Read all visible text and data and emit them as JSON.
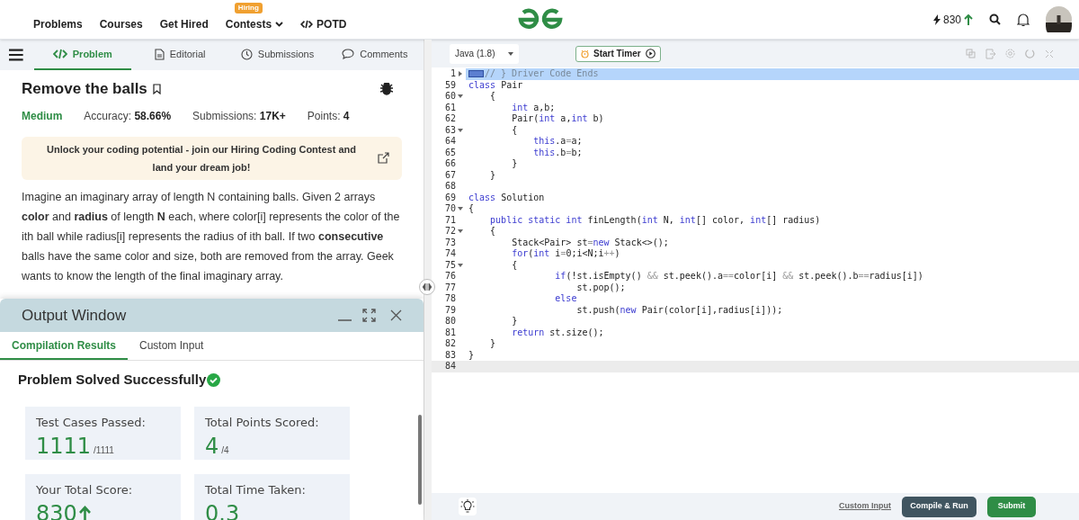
{
  "header": {
    "nav": [
      {
        "label": "Problems"
      },
      {
        "label": "Courses"
      },
      {
        "label": "Get Hired"
      },
      {
        "label": "Contests",
        "badge": "Hiring",
        "dropdown": true
      },
      {
        "label": "POTD",
        "code_icon": true
      }
    ],
    "streak": "830"
  },
  "tabs": [
    {
      "label": "Problem",
      "selected": true
    },
    {
      "label": "Editorial",
      "selected": false
    },
    {
      "label": "Submissions",
      "selected": false
    },
    {
      "label": "Comments",
      "selected": false
    }
  ],
  "problem": {
    "title": "Remove the balls",
    "difficulty": "Medium",
    "meta": [
      {
        "label": "Accuracy:",
        "value": "58.66%"
      },
      {
        "label": "Submissions:",
        "value": "17K+"
      },
      {
        "label": "Points:",
        "value": "4"
      }
    ],
    "banner": "Unlock your coding potential - join our Hiring Coding Contest and land your dream job!",
    "description": "Imagine an imaginary array of length N containing balls. Given 2 arrays **color** and **radius** of length **N** each, where color[i] represents the color of the ith ball while radius[i] represents the radius of ith ball. If two **consecutive** balls have the same color and size, both are removed from the array. Geek wants to know the length of the final imaginary array."
  },
  "output_window": {
    "title": "Output Window",
    "tabs": [
      {
        "label": "Compilation Results",
        "selected": true
      },
      {
        "label": "Custom Input",
        "selected": false
      }
    ],
    "status": "Problem Solved Successfully",
    "stats": [
      {
        "label": "Test Cases Passed:",
        "value": "1111",
        "total": "/1111"
      },
      {
        "label": "Total Points Scored:",
        "value": "4",
        "total": "/4"
      },
      {
        "label": "Your Total Score:",
        "value": "830",
        "arrow": true
      },
      {
        "label": "Total Time Taken:",
        "value": "0.3"
      }
    ]
  },
  "editor": {
    "language": "Java (1.8)",
    "timer_button": "Start Timer",
    "lines": [
      {
        "n": "1",
        "foldable": true,
        "collapsed": true,
        "selected": true,
        "fold_marker": true,
        "code": [
          {
            "t": "// } Driver Code Ends",
            "comment": true
          }
        ]
      },
      {
        "n": "59",
        "code": [
          {
            "t": "class",
            "keyword": true
          },
          {
            "t": " Pair"
          }
        ]
      },
      {
        "n": "60",
        "foldable": true,
        "collapsed": false,
        "code": [
          {
            "t": "    {"
          }
        ]
      },
      {
        "n": "61",
        "code": [
          {
            "t": "        int",
            "keyword": true
          },
          {
            "t": " a,b;"
          }
        ]
      },
      {
        "n": "62",
        "code": [
          {
            "t": "        Pair("
          },
          {
            "t": "int",
            "keyword": true
          },
          {
            "t": " a,"
          },
          {
            "t": "int",
            "keyword": true
          },
          {
            "t": " b)"
          }
        ]
      },
      {
        "n": "63",
        "foldable": true,
        "collapsed": false,
        "code": [
          {
            "t": "        {"
          }
        ]
      },
      {
        "n": "64",
        "code": [
          {
            "t": "            this",
            "keyword": true
          },
          {
            "t": ".a"
          },
          {
            "t": "=",
            "operator": true
          },
          {
            "t": "a;"
          }
        ]
      },
      {
        "n": "65",
        "code": [
          {
            "t": "            this",
            "keyword": true
          },
          {
            "t": ".b"
          },
          {
            "t": "=",
            "operator": true
          },
          {
            "t": "b;"
          }
        ]
      },
      {
        "n": "66",
        "code": [
          {
            "t": "        }"
          }
        ]
      },
      {
        "n": "67",
        "code": [
          {
            "t": "    }"
          }
        ]
      },
      {
        "n": "68"
      },
      {
        "n": "69",
        "code": [
          {
            "t": "class",
            "keyword": true
          },
          {
            "t": " Solution"
          }
        ]
      },
      {
        "n": "70",
        "foldable": true,
        "collapsed": false,
        "code": [
          {
            "t": "{"
          }
        ]
      },
      {
        "n": "71",
        "code": [
          {
            "t": "    public static int",
            "keyword": true
          },
          {
            "t": " finLength("
          },
          {
            "t": "int",
            "keyword": true
          },
          {
            "t": " N, "
          },
          {
            "t": "int",
            "keyword": true
          },
          {
            "t": "[] color, "
          },
          {
            "t": "int",
            "keyword": true
          },
          {
            "t": "[] radius)"
          }
        ]
      },
      {
        "n": "72",
        "foldable": true,
        "collapsed": false,
        "code": [
          {
            "t": "    {"
          }
        ]
      },
      {
        "n": "73",
        "code": [
          {
            "t": "        Stack<Pair> st"
          },
          {
            "t": "=",
            "operator": true
          },
          {
            "t": "new",
            "keyword": true
          },
          {
            "t": " Stack<>();"
          }
        ]
      },
      {
        "n": "74",
        "code": [
          {
            "t": "        for",
            "keyword": true
          },
          {
            "t": "("
          },
          {
            "t": "int",
            "keyword": true
          },
          {
            "t": " i"
          },
          {
            "t": "=",
            "operator": true
          },
          {
            "t": "0;i<N;i"
          },
          {
            "t": "++",
            "operator": true
          },
          {
            "t": ")"
          }
        ]
      },
      {
        "n": "75",
        "foldable": true,
        "collapsed": false,
        "code": [
          {
            "t": "        {"
          }
        ]
      },
      {
        "n": "76",
        "code": [
          {
            "t": "                if",
            "keyword": true
          },
          {
            "t": "(!st.isEmpty() "
          },
          {
            "t": "&&",
            "operator": true
          },
          {
            "t": " st.peek().a"
          },
          {
            "t": "==",
            "operator": true
          },
          {
            "t": "color[i] "
          },
          {
            "t": "&&",
            "operator": true
          },
          {
            "t": " st.peek().b"
          },
          {
            "t": "==",
            "operator": true
          },
          {
            "t": "radius[i])"
          }
        ]
      },
      {
        "n": "77",
        "code": [
          {
            "t": "                    st.pop();"
          }
        ]
      },
      {
        "n": "78",
        "code": [
          {
            "t": "                else",
            "keyword": true
          }
        ]
      },
      {
        "n": "79",
        "code": [
          {
            "t": "                    st.push("
          },
          {
            "t": "new",
            "keyword": true
          },
          {
            "t": " Pair(color[i],radius[i]));"
          }
        ]
      },
      {
        "n": "80",
        "code": [
          {
            "t": "        }"
          }
        ]
      },
      {
        "n": "81",
        "code": [
          {
            "t": "        return",
            "keyword": true
          },
          {
            "t": " st.size();"
          }
        ]
      },
      {
        "n": "82",
        "code": [
          {
            "t": "    }"
          }
        ]
      },
      {
        "n": "83",
        "code": [
          {
            "t": "}"
          }
        ]
      },
      {
        "n": "84",
        "current": true
      }
    ]
  },
  "footer": {
    "link": "Custom Input",
    "compile_button": "Compile & Run",
    "submit_button": "Submit"
  }
}
